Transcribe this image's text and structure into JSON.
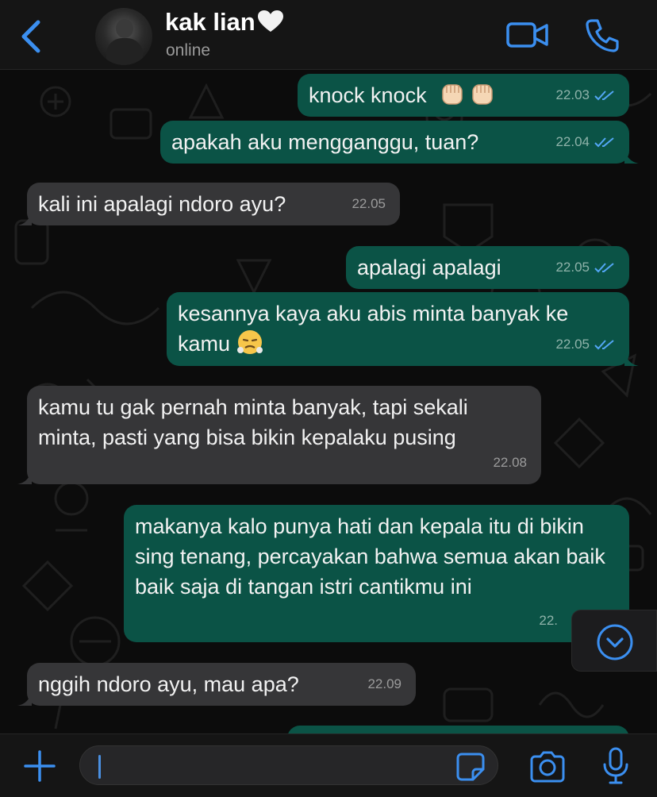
{
  "header": {
    "contact_name": "kak lian",
    "status": "online"
  },
  "messages": [
    {
      "direction": "outgoing",
      "text": "knock knock",
      "emoji": "raised-fist-light-skin x2",
      "time": "22.03",
      "read": true
    },
    {
      "direction": "outgoing",
      "text": "apakah aku mengganggu, tuan?",
      "time": "22.04",
      "read": true
    },
    {
      "direction": "incoming",
      "text": "kali ini apalagi ndoro ayu?",
      "time": "22.05"
    },
    {
      "direction": "outgoing",
      "text": "apalagi apalagi",
      "time": "22.05",
      "read": true
    },
    {
      "direction": "outgoing",
      "text": "kesannya kaya aku abis minta banyak ke kamu",
      "emoji": "face-with-steam-from-nose",
      "time": "22.05",
      "read": true
    },
    {
      "direction": "incoming",
      "text": "kamu tu gak pernah minta banyak, tapi sekali minta, pasti yang bisa bikin kepalaku pusing",
      "time": "22.08"
    },
    {
      "direction": "outgoing",
      "text": "makanya kalo punya hati dan kepala itu di bikin sing tenang, percayakan bahwa semua akan baik baik saja di tangan istri cantikmu ini",
      "time": "22.",
      "read": true
    },
    {
      "direction": "incoming",
      "text": "nggih ndoro ayu, mau apa?",
      "time": "22.09"
    }
  ],
  "icons": {
    "back": "chevron-left-icon",
    "video_call": "video-camera-icon",
    "voice_call": "phone-icon",
    "scroll_down": "chevron-down-circle-icon",
    "attach": "plus-icon",
    "sticker": "sticker-icon",
    "camera": "camera-icon",
    "microphone": "microphone-icon"
  },
  "colors": {
    "accent": "#3b8ff0",
    "outgoing_bubble": "#0b5346",
    "incoming_bubble": "#363638",
    "read_ticks": "#53a6f5",
    "heart": "#f2f2f2"
  },
  "input": {
    "value": "",
    "placeholder": ""
  }
}
